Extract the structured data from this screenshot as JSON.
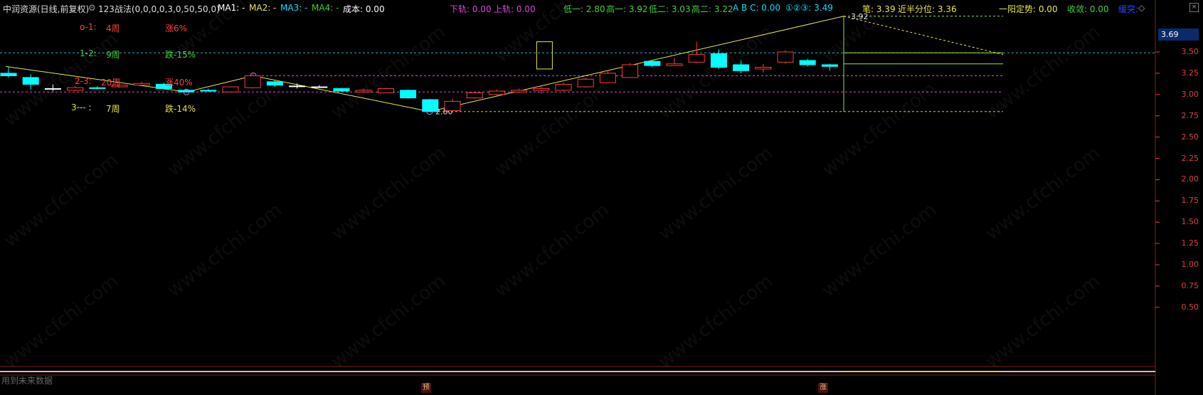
{
  "header": {
    "stock_name": "中润资源(日线,前复权)",
    "indicator": "123战法(0,0,0,0,3,0,50,50,0)",
    "ma1": "MA1: -",
    "ma2": "MA2: -",
    "ma3": "MA3: -",
    "ma4": "MA4: -",
    "cost": "成本: 0.00",
    "lower_rail": "下轨: 0.00",
    "upper_rail": "上轨: 0.00",
    "low1": "低一: 2.80",
    "high1": "高一: 3.92",
    "low2": "低二: 3.03",
    "high2": "高二: 3.22",
    "abc": "A B C: 0.00",
    "circled": "①②③: 3.49",
    "bi": "笔: 3.39",
    "half_quantile": "近半分位: 3.36",
    "yiyang": "一阳定势: 0.00",
    "shoulian": "收敛: 0.00",
    "xu": "缓突:"
  },
  "stats": [
    {
      "label": "o-1: ",
      "period": "4周",
      "change": "涨6%",
      "color": "#ff4040"
    },
    {
      "label": "1-2: ",
      "period": "9周",
      "change": "跌-15%",
      "color": "#40d040"
    },
    {
      "label": "2-3: ",
      "period": "20周",
      "change": "涨40%",
      "color": "#ff4040"
    },
    {
      "label": "3---  :",
      "period": "7周",
      "change": "跌-14%",
      "color": "#e0e040"
    }
  ],
  "price_tag": "3.69",
  "pivot_labels": {
    "low": "2.80",
    "high": "3.92"
  },
  "bottom": {
    "note": "用到未来数据",
    "mark_pre": "预",
    "mark_zhang": "涨"
  },
  "watermark": "www.cfchi.com",
  "colors": {
    "up": "#ff3b3b",
    "down": "#00ffff",
    "flat": "#ffffff",
    "zigzag": "#e8e84a",
    "axis": "#e04040",
    "cyan_line": "#1fb5c8",
    "magenta_line": "#d050d0",
    "green_line": "#a0e040"
  },
  "chart_data": {
    "type": "candlestick",
    "y_ticks": [
      "3.50",
      "3.25",
      "3.00",
      "2.75",
      "2.50",
      "2.25",
      "2.00",
      "1.75",
      "1.50",
      "1.25",
      "1.00",
      "0.75",
      "0.50"
    ],
    "ylim": [
      0.3,
      3.95
    ],
    "candles": [
      {
        "o": 3.25,
        "c": 3.22,
        "h": 3.33,
        "l": 3.2
      },
      {
        "o": 3.2,
        "c": 3.12,
        "h": 3.24,
        "l": 3.06
      },
      {
        "o": 3.07,
        "c": 3.07,
        "h": 3.12,
        "l": 3.04
      },
      {
        "o": 3.05,
        "c": 3.08,
        "h": 3.1,
        "l": 3.04
      },
      {
        "o": 3.08,
        "c": 3.07,
        "h": 3.1,
        "l": 3.06
      },
      {
        "o": 3.09,
        "c": 3.11,
        "h": 3.12,
        "l": 3.08
      },
      {
        "o": 3.11,
        "c": 3.13,
        "h": 3.15,
        "l": 3.1
      },
      {
        "o": 3.12,
        "c": 3.07,
        "h": 3.14,
        "l": 3.06
      },
      {
        "o": 3.05,
        "c": 3.03,
        "h": 3.06,
        "l": 3.02
      },
      {
        "o": 3.05,
        "c": 3.04,
        "h": 3.07,
        "l": 3.03
      },
      {
        "o": 3.03,
        "c": 3.09,
        "h": 3.09,
        "l": 3.03
      },
      {
        "o": 3.08,
        "c": 3.22,
        "h": 3.24,
        "l": 3.07
      },
      {
        "o": 3.15,
        "c": 3.11,
        "h": 3.17,
        "l": 3.09
      },
      {
        "o": 3.1,
        "c": 3.1,
        "h": 3.13,
        "l": 3.07
      },
      {
        "o": 3.09,
        "c": 3.09,
        "h": 3.11,
        "l": 3.08
      },
      {
        "o": 3.07,
        "c": 3.04,
        "h": 3.08,
        "l": 3.03
      },
      {
        "o": 3.03,
        "c": 3.05,
        "h": 3.07,
        "l": 3.02
      },
      {
        "o": 3.02,
        "c": 3.07,
        "h": 3.08,
        "l": 3.02
      },
      {
        "o": 3.05,
        "c": 2.96,
        "h": 3.06,
        "l": 2.95
      },
      {
        "o": 2.94,
        "c": 2.8,
        "h": 2.95,
        "l": 2.79
      },
      {
        "o": 2.81,
        "c": 2.92,
        "h": 2.95,
        "l": 2.8
      },
      {
        "o": 2.96,
        "c": 3.02,
        "h": 3.03,
        "l": 2.95
      },
      {
        "o": 3.0,
        "c": 3.04,
        "h": 3.06,
        "l": 2.99
      },
      {
        "o": 3.03,
        "c": 3.05,
        "h": 3.07,
        "l": 3.02
      },
      {
        "o": 3.05,
        "c": 3.07,
        "h": 3.11,
        "l": 3.01
      },
      {
        "o": 3.05,
        "c": 3.12,
        "h": 3.14,
        "l": 3.04
      },
      {
        "o": 3.09,
        "c": 3.18,
        "h": 3.2,
        "l": 3.08
      },
      {
        "o": 3.14,
        "c": 3.25,
        "h": 3.28,
        "l": 3.13
      },
      {
        "o": 3.2,
        "c": 3.35,
        "h": 3.37,
        "l": 3.2
      },
      {
        "o": 3.39,
        "c": 3.34,
        "h": 3.4,
        "l": 3.32
      },
      {
        "o": 3.34,
        "c": 3.36,
        "h": 3.43,
        "l": 3.34
      },
      {
        "o": 3.38,
        "c": 3.47,
        "h": 3.62,
        "l": 3.37
      },
      {
        "o": 3.48,
        "c": 3.32,
        "h": 3.53,
        "l": 3.3
      },
      {
        "o": 3.35,
        "c": 3.28,
        "h": 3.4,
        "l": 3.25
      },
      {
        "o": 3.3,
        "c": 3.32,
        "h": 3.36,
        "l": 3.26
      },
      {
        "o": 3.38,
        "c": 3.5,
        "h": 3.52,
        "l": 3.36
      },
      {
        "o": 3.4,
        "c": 3.35,
        "h": 3.42,
        "l": 3.33
      },
      {
        "o": 3.35,
        "c": 3.33,
        "h": 3.36,
        "l": 3.28
      }
    ]
  }
}
